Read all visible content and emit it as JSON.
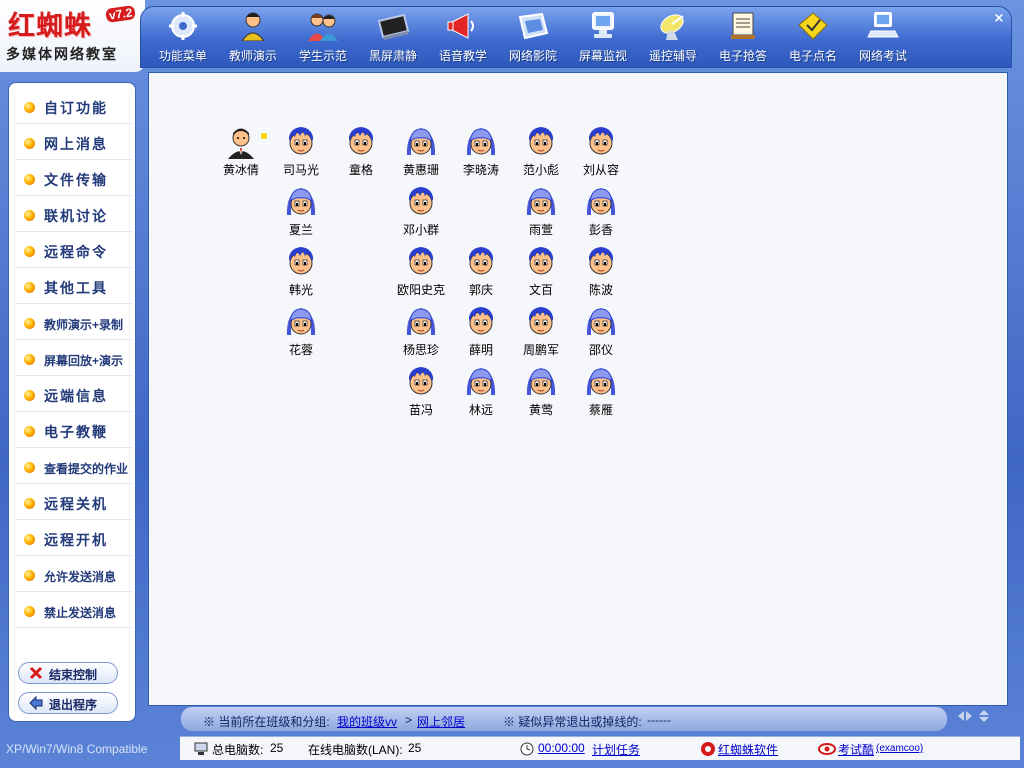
{
  "logo": {
    "title": "红蜘蛛",
    "version": "v7.2",
    "subtitle": "多媒体网络教室"
  },
  "toolbar": {
    "buttons": [
      {
        "label": "功能菜单",
        "icon": "gear-icon"
      },
      {
        "label": "教师演示",
        "icon": "teacher-icon"
      },
      {
        "label": "学生示范",
        "icon": "students-icon"
      },
      {
        "label": "黑屏肃静",
        "icon": "black-screen-icon"
      },
      {
        "label": "语音教学",
        "icon": "megaphone-icon"
      },
      {
        "label": "网络影院",
        "icon": "cinema-icon"
      },
      {
        "label": "屏幕监视",
        "icon": "monitor-icon"
      },
      {
        "label": "遥控辅导",
        "icon": "satellite-dish-icon"
      },
      {
        "label": "电子抢答",
        "icon": "answer-board-icon"
      },
      {
        "label": "电子点名",
        "icon": "roll-call-icon"
      },
      {
        "label": "网络考试",
        "icon": "exam-computer-icon"
      }
    ]
  },
  "sidebar": {
    "items": [
      {
        "label": "自订功能"
      },
      {
        "label": "网上消息"
      },
      {
        "label": "文件传输"
      },
      {
        "label": "联机讨论"
      },
      {
        "label": "远程命令"
      },
      {
        "label": "其他工具"
      },
      {
        "label": "教师演示+录制"
      },
      {
        "label": "屏幕回放+演示"
      },
      {
        "label": "远端信息"
      },
      {
        "label": "电子教鞭"
      },
      {
        "label": "查看提交的作业"
      },
      {
        "label": "远程关机"
      },
      {
        "label": "远程开机"
      },
      {
        "label": "允许发送消息"
      },
      {
        "label": "禁止发送消息"
      }
    ],
    "actions": {
      "end_control": "结束控制",
      "exit_program": "退出程序"
    },
    "compat": "XP/Win7/Win8 Compatible"
  },
  "teacher": {
    "name": "黄冰倩"
  },
  "students": [
    {
      "name": "司马光",
      "type": "boy"
    },
    {
      "name": "童格",
      "type": "boy"
    },
    {
      "name": "黄惠珊",
      "type": "girl"
    },
    {
      "name": "李晓涛",
      "type": "girl"
    },
    {
      "name": "范小彪",
      "type": "boy"
    },
    {
      "name": "刘从容",
      "type": "boy"
    },
    {
      "name": "夏兰",
      "type": "girl"
    },
    {
      "name": "邓小群",
      "type": "boy"
    },
    {
      "name": "雨萱",
      "type": "girl"
    },
    {
      "name": "彭香",
      "type": "girl"
    },
    {
      "name": "韩光",
      "type": "boy"
    },
    {
      "name": "欧阳史克",
      "type": "boy"
    },
    {
      "name": "郭庆",
      "type": "boy"
    },
    {
      "name": "文百",
      "type": "boy"
    },
    {
      "name": "陈波",
      "type": "boy"
    },
    {
      "name": "花蓉",
      "type": "girl"
    },
    {
      "name": "杨思珍",
      "type": "girl"
    },
    {
      "name": "薛明",
      "type": "boy"
    },
    {
      "name": "周鹏军",
      "type": "boy"
    },
    {
      "name": "邵仪",
      "type": "girl"
    },
    {
      "name": "苗冯",
      "type": "boy"
    },
    {
      "name": "林远",
      "type": "girl"
    },
    {
      "name": "黄莺",
      "type": "girl"
    },
    {
      "name": "蔡雁",
      "type": "girl"
    }
  ],
  "status": {
    "prefix": "※ 当前所在班级和分组:",
    "class_link": "我的班级vv",
    "separator": ">",
    "group_link": "网上邻居",
    "abnormal_prefix": "※ 疑似异常退出或掉线的:",
    "abnormal_value": "------"
  },
  "footer": {
    "total_label": "总电脑数:",
    "total_value": "25",
    "online_label": "在线电脑数(LAN):",
    "online_value": "25",
    "schedule_time": "00:00:00",
    "schedule_label": "计划任务",
    "brand_link": "红蜘蛛软件",
    "exam_link": "考试酷",
    "exam_suffix": "(examcoo)"
  },
  "colors": {
    "frame_blue": "#3f67c4",
    "logo_red": "#d51b1b",
    "link_blue": "#0000cc",
    "student_hair": "#2a3fcf",
    "student_skin": "#ffc08a"
  }
}
